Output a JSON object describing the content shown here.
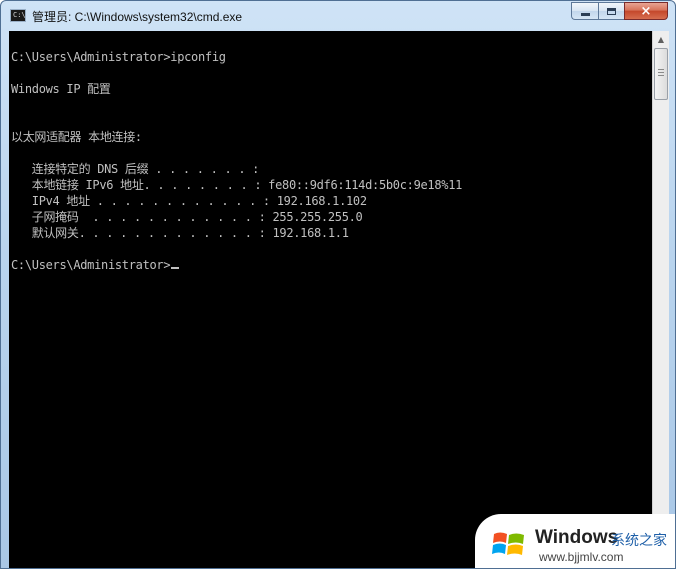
{
  "window": {
    "title": "管理员: C:\\Windows\\system32\\cmd.exe",
    "icon": "cmd-icon",
    "buttons": {
      "minimize": "minimize-icon",
      "maximize": "maximize-icon",
      "close": "×"
    }
  },
  "console": {
    "lines": [
      "C:\\Users\\Administrator>ipconfig",
      "",
      "Windows IP 配置",
      "",
      "",
      "以太网适配器 本地连接:",
      "",
      "   连接特定的 DNS 后缀 . . . . . . . :",
      "   本地链接 IPv6 地址. . . . . . . . : fe80::9df6:114d:5b0c:9e18%11",
      "   IPv4 地址 . . . . . . . . . . . . : 192.168.1.102",
      "   子网掩码  . . . . . . . . . . . . : 255.255.255.0",
      "   默认网关. . . . . . . . . . . . . : 192.168.1.1",
      "",
      "C:\\Users\\Administrator>"
    ],
    "text_color": "#c0c0c0",
    "background": "#000000"
  },
  "watermark": {
    "brand": "Windows",
    "site_cn": "系统之家",
    "url": "www.bjjmlv.com"
  }
}
